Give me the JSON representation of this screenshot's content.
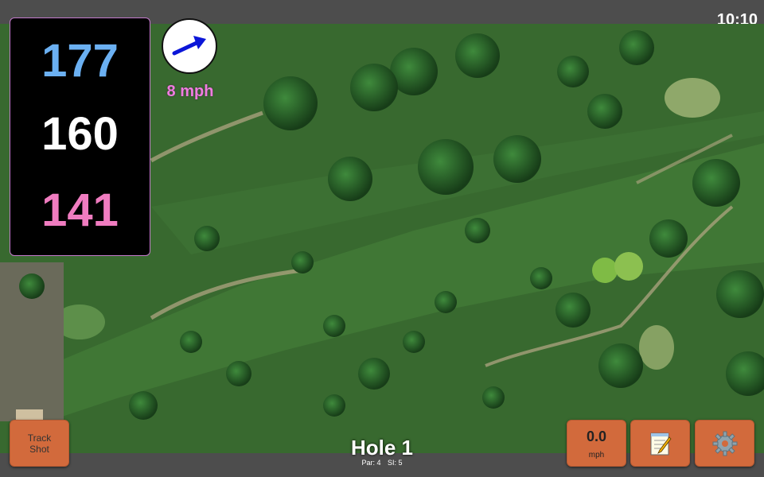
{
  "status_bar": {
    "time": "10:10"
  },
  "distances": {
    "back": "177",
    "middle": "160",
    "front": "141"
  },
  "wind": {
    "speed_label": "8 mph",
    "direction_icon": "arrow-icon",
    "arrow_color": "#0b16d8"
  },
  "hole": {
    "title": "Hole 1",
    "par": "Par: 4",
    "stroke_index": "SI: 5"
  },
  "buttons": {
    "track_shot": "Track Shot",
    "wind_value": "0.0",
    "wind_unit": "mph",
    "notes_icon": "notepad-icon",
    "settings_icon": "gear-icon"
  },
  "colors": {
    "button": "#d26a3c",
    "back_distance": "#6bb0f2",
    "front_distance": "#f07cc0",
    "wind_label": "#f07ce0"
  }
}
